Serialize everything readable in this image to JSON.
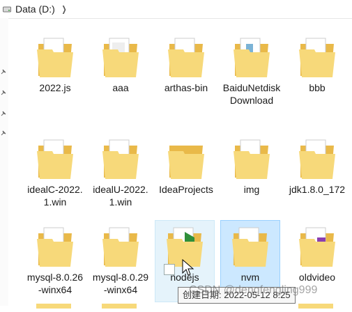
{
  "address_bar": {
    "path": "Data (D:)",
    "chevron_icon": "chevron-right-icon",
    "drive_icon": "drive-icon"
  },
  "colors": {
    "folder_light": "#f7d97a",
    "folder_dark": "#e9b949",
    "paper": "#ffffff",
    "selected_bg": "#cce8ff",
    "hover_bg": "#e5f3fb"
  },
  "items": [
    {
      "id": "2022js",
      "label": "2022.js"
    },
    {
      "id": "aaa",
      "label": "aaa"
    },
    {
      "id": "arthas-bin",
      "label": "arthas-bin"
    },
    {
      "id": "baidunetdisk",
      "label": "BaiduNetdiskDownload"
    },
    {
      "id": "bbb",
      "label": "bbb"
    },
    {
      "id": "idealc",
      "label": "idealC-2022.1.win"
    },
    {
      "id": "idealu",
      "label": "idealU-2022.1.win"
    },
    {
      "id": "ideaprojects",
      "label": "IdeaProjects"
    },
    {
      "id": "img",
      "label": "img"
    },
    {
      "id": "jdk",
      "label": "jdk1.8.0_172"
    },
    {
      "id": "mysql26",
      "label": "mysql-8.0.26-winx64"
    },
    {
      "id": "mysql29",
      "label": "mysql-8.0.29-winx64"
    },
    {
      "id": "nodejs",
      "label": "nodejs",
      "state": "hovered",
      "shortcut": true
    },
    {
      "id": "nvm",
      "label": "nvm",
      "state": "selected"
    },
    {
      "id": "oldvideo",
      "label": "oldvideo"
    }
  ],
  "tooltip": {
    "text": "创建日期: 2022-05-12 8:25"
  },
  "watermark": {
    "text": "CSDN @dengfengling999"
  }
}
